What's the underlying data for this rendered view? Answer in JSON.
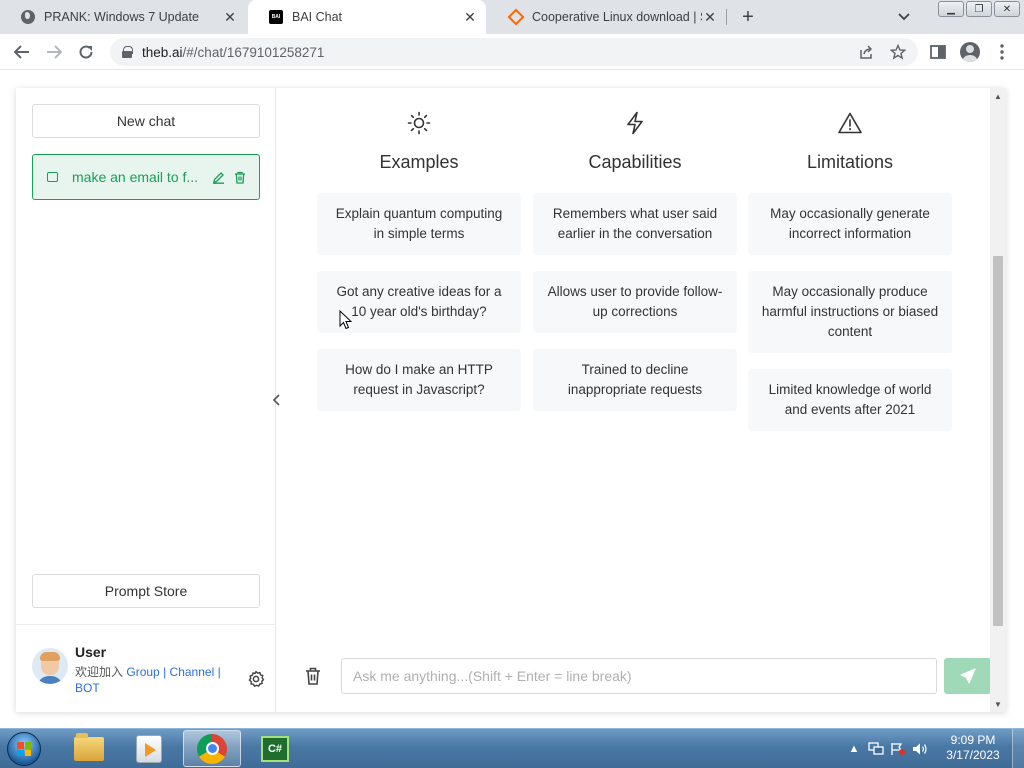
{
  "browser": {
    "tabs": [
      {
        "title": "PRANK: Windows 7 Update",
        "favicon": "globe-icon"
      },
      {
        "title": "BAI Chat",
        "favicon": "bai-logo-icon"
      },
      {
        "title": "Cooperative Linux download | So",
        "favicon": "sourceforge-icon"
      }
    ],
    "bai_favicon_text": "BAI",
    "url_host": "theb.ai",
    "url_path": "/#/chat/1679101258271"
  },
  "sidebar": {
    "new_chat_label": "New chat",
    "chats": [
      {
        "title": "make an email to f..."
      }
    ],
    "prompt_store_label": "Prompt Store",
    "user": {
      "name": "User",
      "join_text": "欢迎加入",
      "links": [
        "Group",
        "Channel",
        "BOT"
      ],
      "separator": "|"
    }
  },
  "main": {
    "columns": [
      {
        "icon": "sun-icon",
        "title": "Examples",
        "cards": [
          "Explain quantum computing in simple terms",
          "Got any creative ideas for a 10 year old's birthday?",
          "How do I make an HTTP request in Javascript?"
        ]
      },
      {
        "icon": "lightning-icon",
        "title": "Capabilities",
        "cards": [
          "Remembers what user said earlier in the conversation",
          "Allows user to provide follow-up corrections",
          "Trained to decline inappropriate requests"
        ]
      },
      {
        "icon": "warning-icon",
        "title": "Limitations",
        "cards": [
          "May occasionally generate incorrect information",
          "May occasionally produce harmful instructions or biased content",
          "Limited knowledge of world and events after 2021"
        ]
      }
    ],
    "input_placeholder": "Ask me anything...(Shift + Enter = line break)"
  },
  "taskbar": {
    "apps": [
      "folder-icon",
      "media-player-icon",
      "chrome-icon",
      "csharp-icon"
    ],
    "cs_icon_text": "C#",
    "time": "9:09 PM",
    "date": "3/17/2023"
  },
  "colors": {
    "accent": "#18a058",
    "accent_light": "#e8f4ee",
    "send_button": "#9fd9b8",
    "link": "#2d70d8"
  }
}
